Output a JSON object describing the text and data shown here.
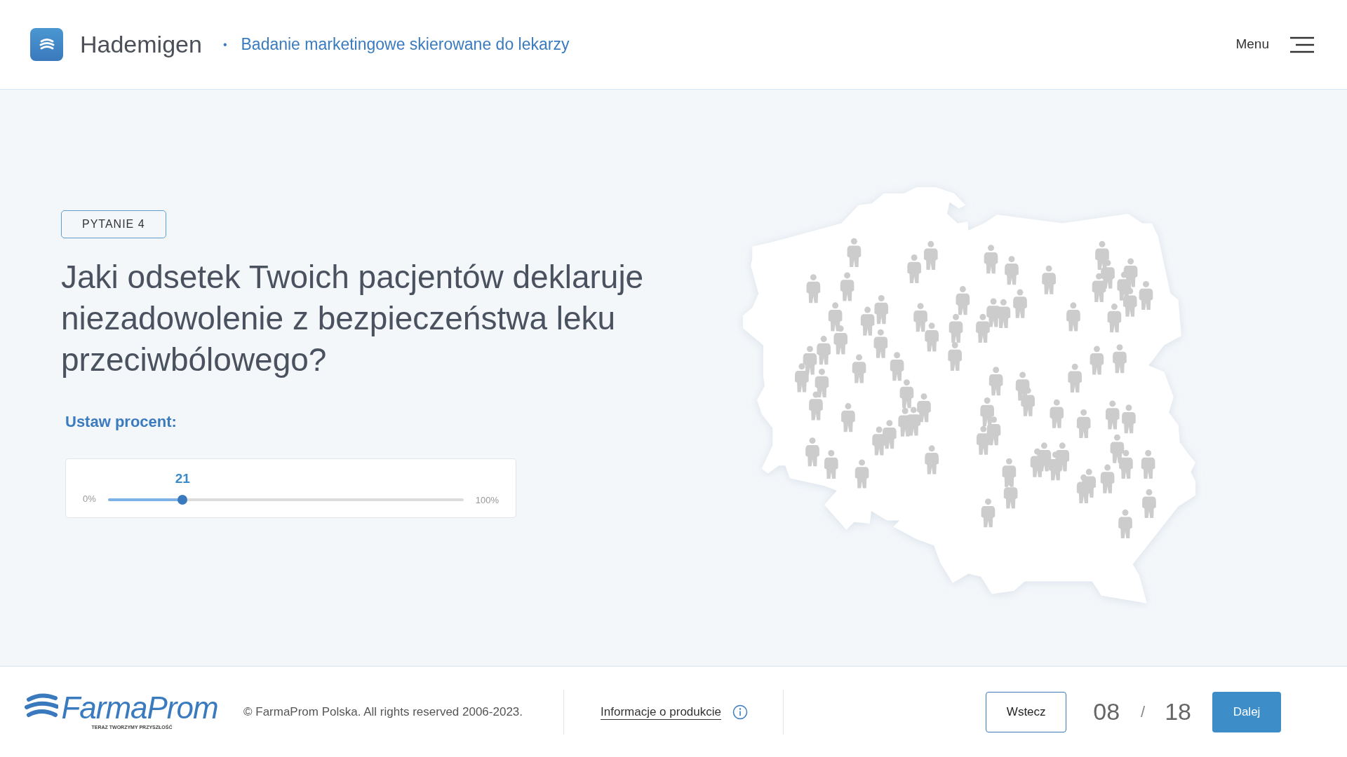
{
  "header": {
    "brand": "Hademigen",
    "separator": "•",
    "subtitle": "Badanie marketingowe skierowane do lekarzy",
    "menu_label": "Menu"
  },
  "question": {
    "badge": "PYTANIE 4",
    "text": "Jaki odsetek Twoich pacjentów deklaruje niezadowolenie z bezpieczeństwa leku przeciwbólowego?",
    "prompt": "Ustaw procent:",
    "slider": {
      "value": "21",
      "min_label": "0%",
      "max_label": "100%",
      "level": 0.21
    }
  },
  "footer": {
    "logo_name": "FarmaProm",
    "logo_tagline": "TERAZ TWORZYMY PRZYSZŁOŚĆ",
    "copyright": "© FarmaProm Polska. All rights reserved 2006-2023.",
    "info_link": "Informacje o produkcie",
    "back_button": "Wstecz",
    "current_page": "08",
    "page_separator": "/",
    "total_pages": "18",
    "next_button": "Dalej"
  }
}
